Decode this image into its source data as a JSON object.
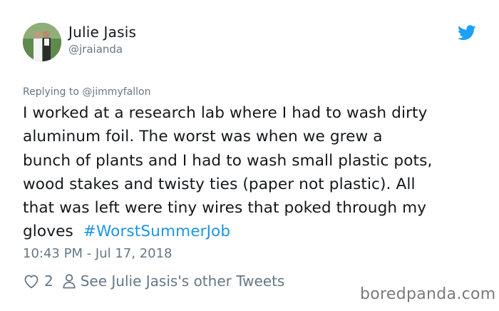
{
  "author": {
    "name": "Julie Jasis",
    "handle": "@jraianda"
  },
  "icons": {
    "platform": "twitter-bird-icon",
    "like": "heart-icon",
    "profile": "person-icon"
  },
  "colors": {
    "hashtag": "#1b95e0",
    "bird": "#1da1f2",
    "secondary_text": "#657786"
  },
  "reply": {
    "prefix": "Replying to ",
    "mention": "@jimmyfallon"
  },
  "body": {
    "lines": [
      "I worked at a research lab where I had to wash dirty",
      "aluminum foil. The worst was when we grew a",
      "bunch of plants and I had to wash small plastic pots,",
      "wood stakes and twisty ties (paper not plastic). All",
      "that was left were tiny wires that poked through my",
      "gloves  "
    ],
    "hashtag": "#WorstSummerJob"
  },
  "timestamp": "10:43 PM - Jul 17, 2018",
  "actions": {
    "like_count": "2",
    "profile_link": "See Julie Jasis's other Tweets"
  },
  "watermark": "boredpanda.com"
}
